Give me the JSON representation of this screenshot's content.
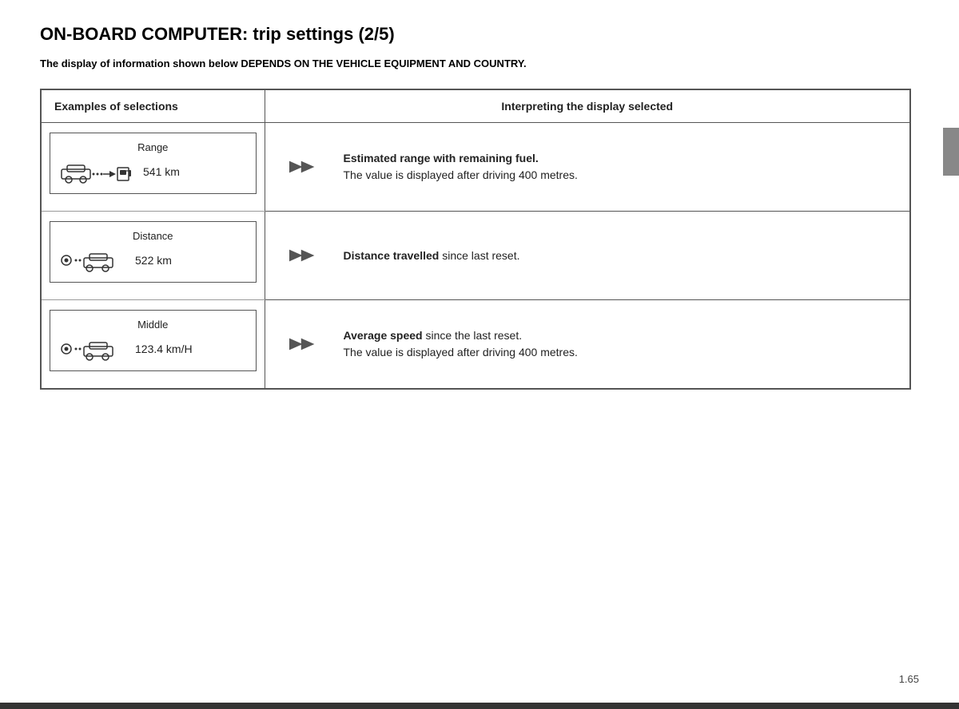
{
  "page": {
    "title": "ON-BOARD COMPUTER: trip settings (2/5)",
    "subtitle": "The display of information shown below DEPENDS ON THE VEHICLE EQUIPMENT AND COUNTRY.",
    "page_number": "1.65"
  },
  "table": {
    "header_left": "Examples of selections",
    "header_right": "Interpreting the display selected",
    "rows": [
      {
        "display_label": "Range",
        "display_value": "541 km",
        "description_bold": "Estimated range with remaining fuel.",
        "description_normal": "\nThe value is displayed after driving 400 metres."
      },
      {
        "display_label": "Distance",
        "display_value": "522 km",
        "description_bold": "Distance travelled",
        "description_normal": " since last reset."
      },
      {
        "display_label": "Middle",
        "display_value": "123.4 km/H",
        "description_bold": "Average speed",
        "description_normal": " since the last reset.\nThe value is displayed after driving 400 metres."
      }
    ]
  }
}
